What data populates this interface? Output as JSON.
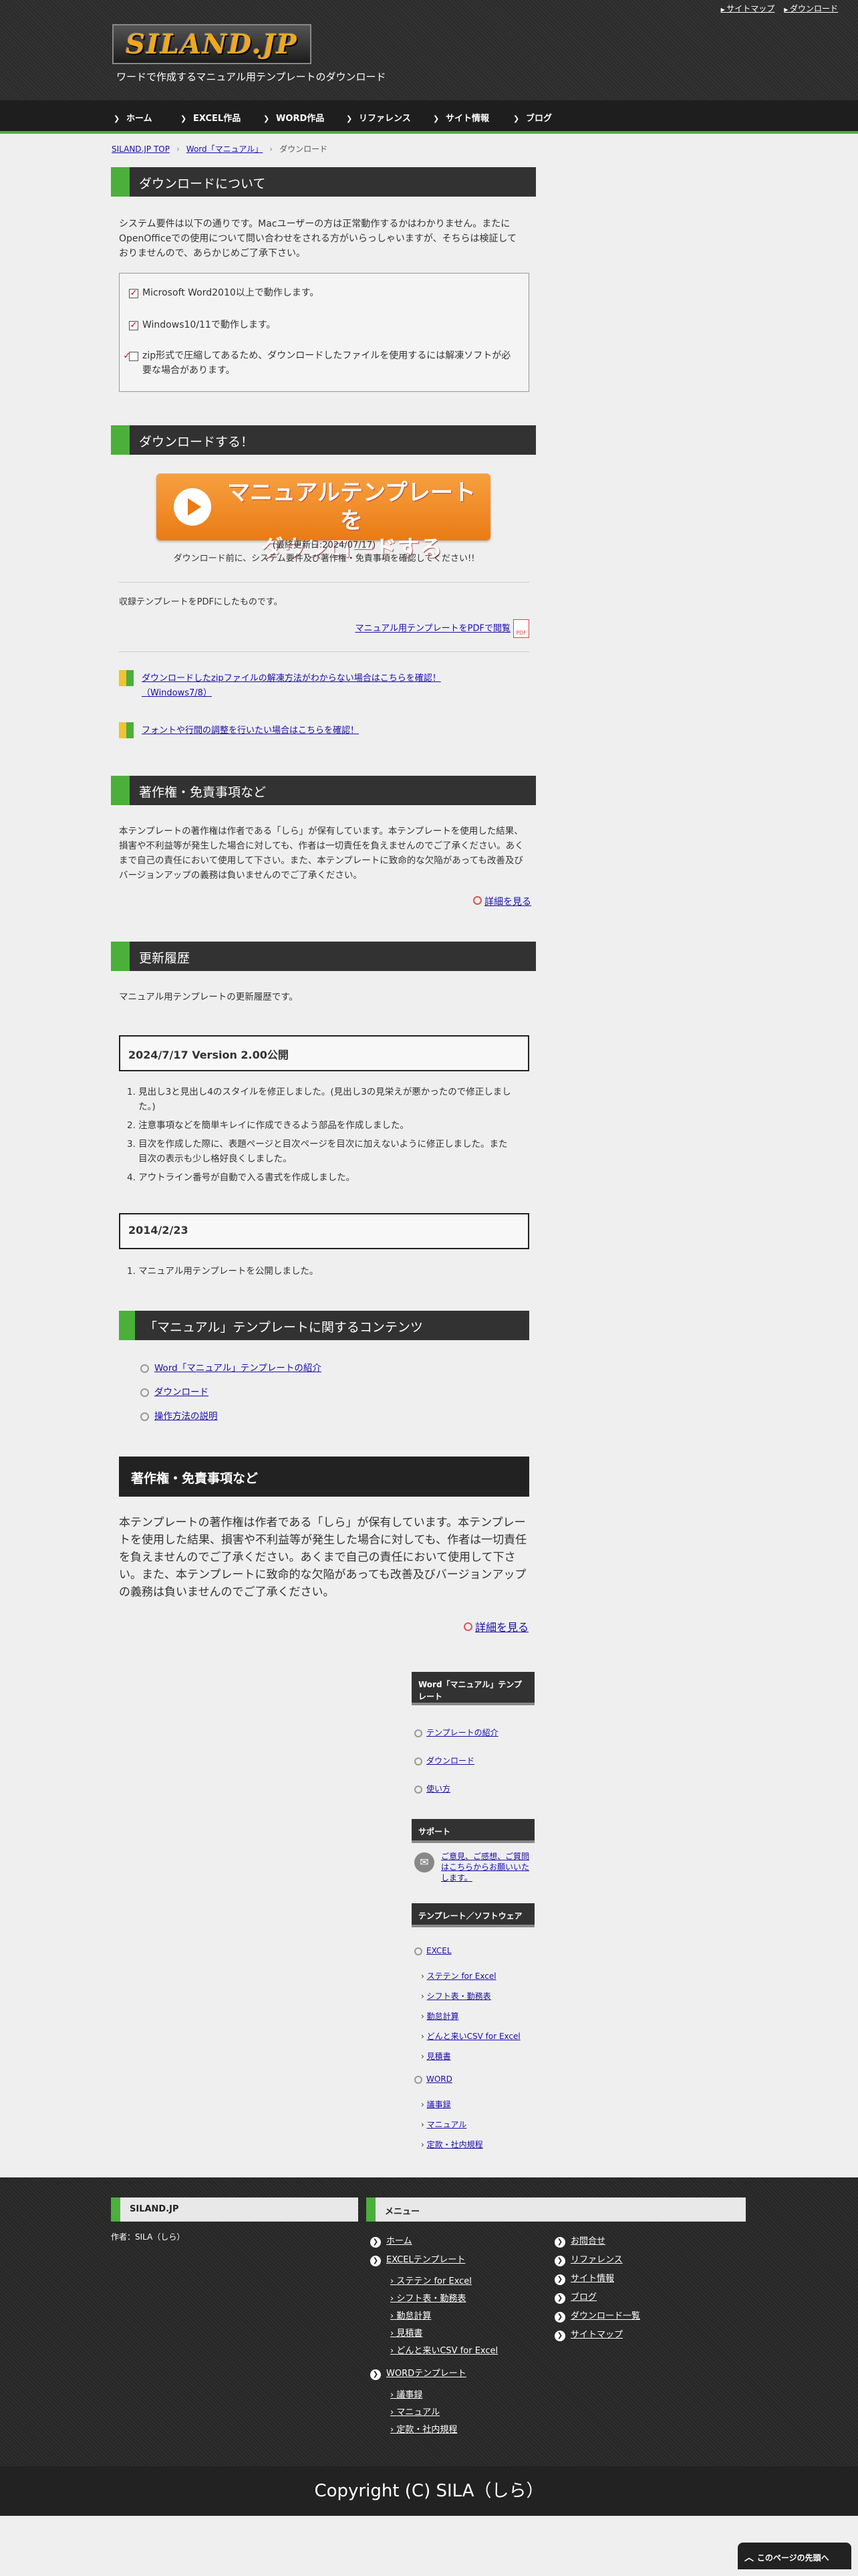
{
  "header": {
    "top_links": [
      "サイトマップ",
      "ダウンロード"
    ],
    "logo": "SILAND.JP",
    "tagline": "ワードで作成するマニュアル用テンプレートのダウンロード"
  },
  "nav": [
    "ホーム",
    "EXCEL作品",
    "WORD作品",
    "リファレンス",
    "サイト情報",
    "ブログ"
  ],
  "breadcrumb": {
    "home": "SILAND.JP TOP",
    "parent": "Word「マニュアル」",
    "current": "ダウンロード"
  },
  "about": {
    "title": "ダウンロードについて",
    "intro": "システム要件は以下の通りです。Macユーザーの方は正常動作するかはわかりません。またにOpenOfficeでの使用について問い合わせをされる方がいらっしゃいますが、そちらは検証しておりませんので、あらかじめご了承下さい。",
    "requirements": [
      "Microsoft Word2010以上で動作します。",
      "Windows10/11で動作します。",
      "zip形式で圧縮してあるため、ダウンロードしたファイルを使用するには解凍ソフトが必要な場合があります。"
    ]
  },
  "download": {
    "title": "ダウンロードする！",
    "button_line1": "マニュアルテンプレートを",
    "button_line2": "ダウンロードする",
    "updated": "(最終更新日:2024/07/17)",
    "note": "ダウンロード前に、システム要件及び著作権・免責事項を確認してください!!",
    "pdf_intro": "収録テンプレートをPDFにしたものです。",
    "pdf_link": "マニュアル用テンプレートをPDFで閲覧",
    "pdf_icon": "PDF",
    "help1": "ダウンロードしたzipファイルの解凍方法がわからない場合はこちらを確認！（Windows7/8）",
    "help2": "フォントや行間の調整を行いたい場合はこちらを確認！"
  },
  "copyright_sec": {
    "title": "著作権・免責事項など",
    "text": "本テンプレートの著作権は作者である「しら」が保有しています。本テンプレートを使用した結果、損害や不利益等が発生した場合に対しても、作者は一切責任を負えませんのでご了承ください。あくまで自己の責任において使用して下さい。また、本テンプレートに致命的な欠陥があっても改善及びバージョンアップの義務は負いませんのでご了承ください。",
    "more": "詳細を見る"
  },
  "history": {
    "title": "更新履歴",
    "intro": "マニュアル用テンプレートの更新履歴です。",
    "v1_title": "2024/7/17 Version 2.00公開",
    "v1_items": [
      "見出し3と見出し4のスタイルを修正しました。(見出し3の見栄えが悪かったので修正しました。)",
      "注意事項などを簡単キレイに作成できるよう部品を作成しました。",
      "目次を作成した際に、表題ページと目次ページを目次に加えないように修正しました。また目次の表示も少し格好良くしました。",
      "アウトライン番号が自動で入る書式を作成しました。"
    ],
    "v0_title": "2014/2/23",
    "v0_items": [
      "マニュアル用テンプレートを公開しました。"
    ]
  },
  "related": {
    "title": "「マニュアル」テンプレートに関するコンテンツ",
    "items": [
      "Word「マニュアル」テンプレートの紹介",
      "ダウンロード",
      "操作方法の説明"
    ]
  },
  "copyright_box": {
    "title": "著作権・免責事項など",
    "text": "本テンプレートの著作権は作者である「しら」が保有しています。本テンプレートを使用した結果、損害や不利益等が発生した場合に対しても、作者は一切責任を負えませんのでご了承ください。あくまで自己の責任において使用して下さい。また、本テンプレートに致命的な欠陥があっても改善及びバージョンアップの義務は負いませんのでご了承ください。",
    "more": "詳細を見る"
  },
  "sidebar": {
    "h1": "Word「マニュアル」テンプレート",
    "links": [
      "テンプレートの紹介",
      "ダウンロード",
      "使い方"
    ],
    "support_h": "サポート",
    "support_text": "ご意見、ご感想、ご質問はこちらからお願いいたします。",
    "tpl_h": "テンプレート／ソフトウェア",
    "excel": "EXCEL",
    "excel_items": [
      "ステテン for Excel",
      "シフト表・勤務表",
      "勤怠計算",
      "どんと来いCSV for Excel",
      "見積書"
    ],
    "word": "WORD",
    "word_items": [
      "議事録",
      "マニュアル",
      "定款・社内規程"
    ]
  },
  "footer": {
    "site_h": "SILAND.JP",
    "author": "作者：SILA（しら）",
    "menu_h": "メニュー",
    "col1": [
      "ホーム",
      "EXCELテンプレート"
    ],
    "col1_sub": [
      "ステテン for Excel",
      "シフト表・勤務表",
      "勤怠計算",
      "見積書",
      "どんと来いCSV for Excel"
    ],
    "col1b": "WORDテンプレート",
    "col1b_sub": [
      "議事録",
      "マニュアル",
      "定款・社内規程"
    ],
    "col2": [
      "お問合せ",
      "リファレンス",
      "サイト情報",
      "ブログ",
      "ダウンロード一覧",
      "サイトマップ"
    ],
    "copyright": "Copyright (C) SILA（しら）",
    "totop": "このページの先頭へ"
  }
}
